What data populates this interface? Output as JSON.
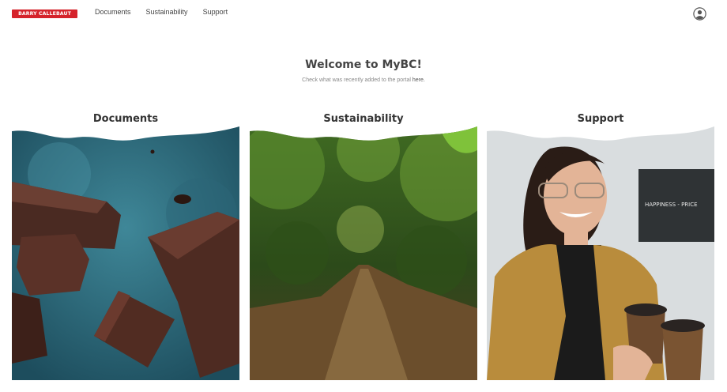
{
  "header": {
    "logo_text": "BARRY CALLEBAUT",
    "nav": [
      "Documents",
      "Sustainability",
      "Support"
    ],
    "user_icon": "user-circle-icon"
  },
  "hero": {
    "title": "Welcome to MyBC!",
    "subtitle_prefix": "Check what was recently added to the portal ",
    "subtitle_link": "here."
  },
  "cards": [
    {
      "title": "Documents",
      "image": "chocolate-pieces-photo"
    },
    {
      "title": "Sustainability",
      "image": "forest-path-photo"
    },
    {
      "title": "Support",
      "image": "woman-with-coffee-photo"
    }
  ],
  "photo_signage": "HAPPINESS - PRICE",
  "colors": {
    "brand": "#d5232b"
  }
}
